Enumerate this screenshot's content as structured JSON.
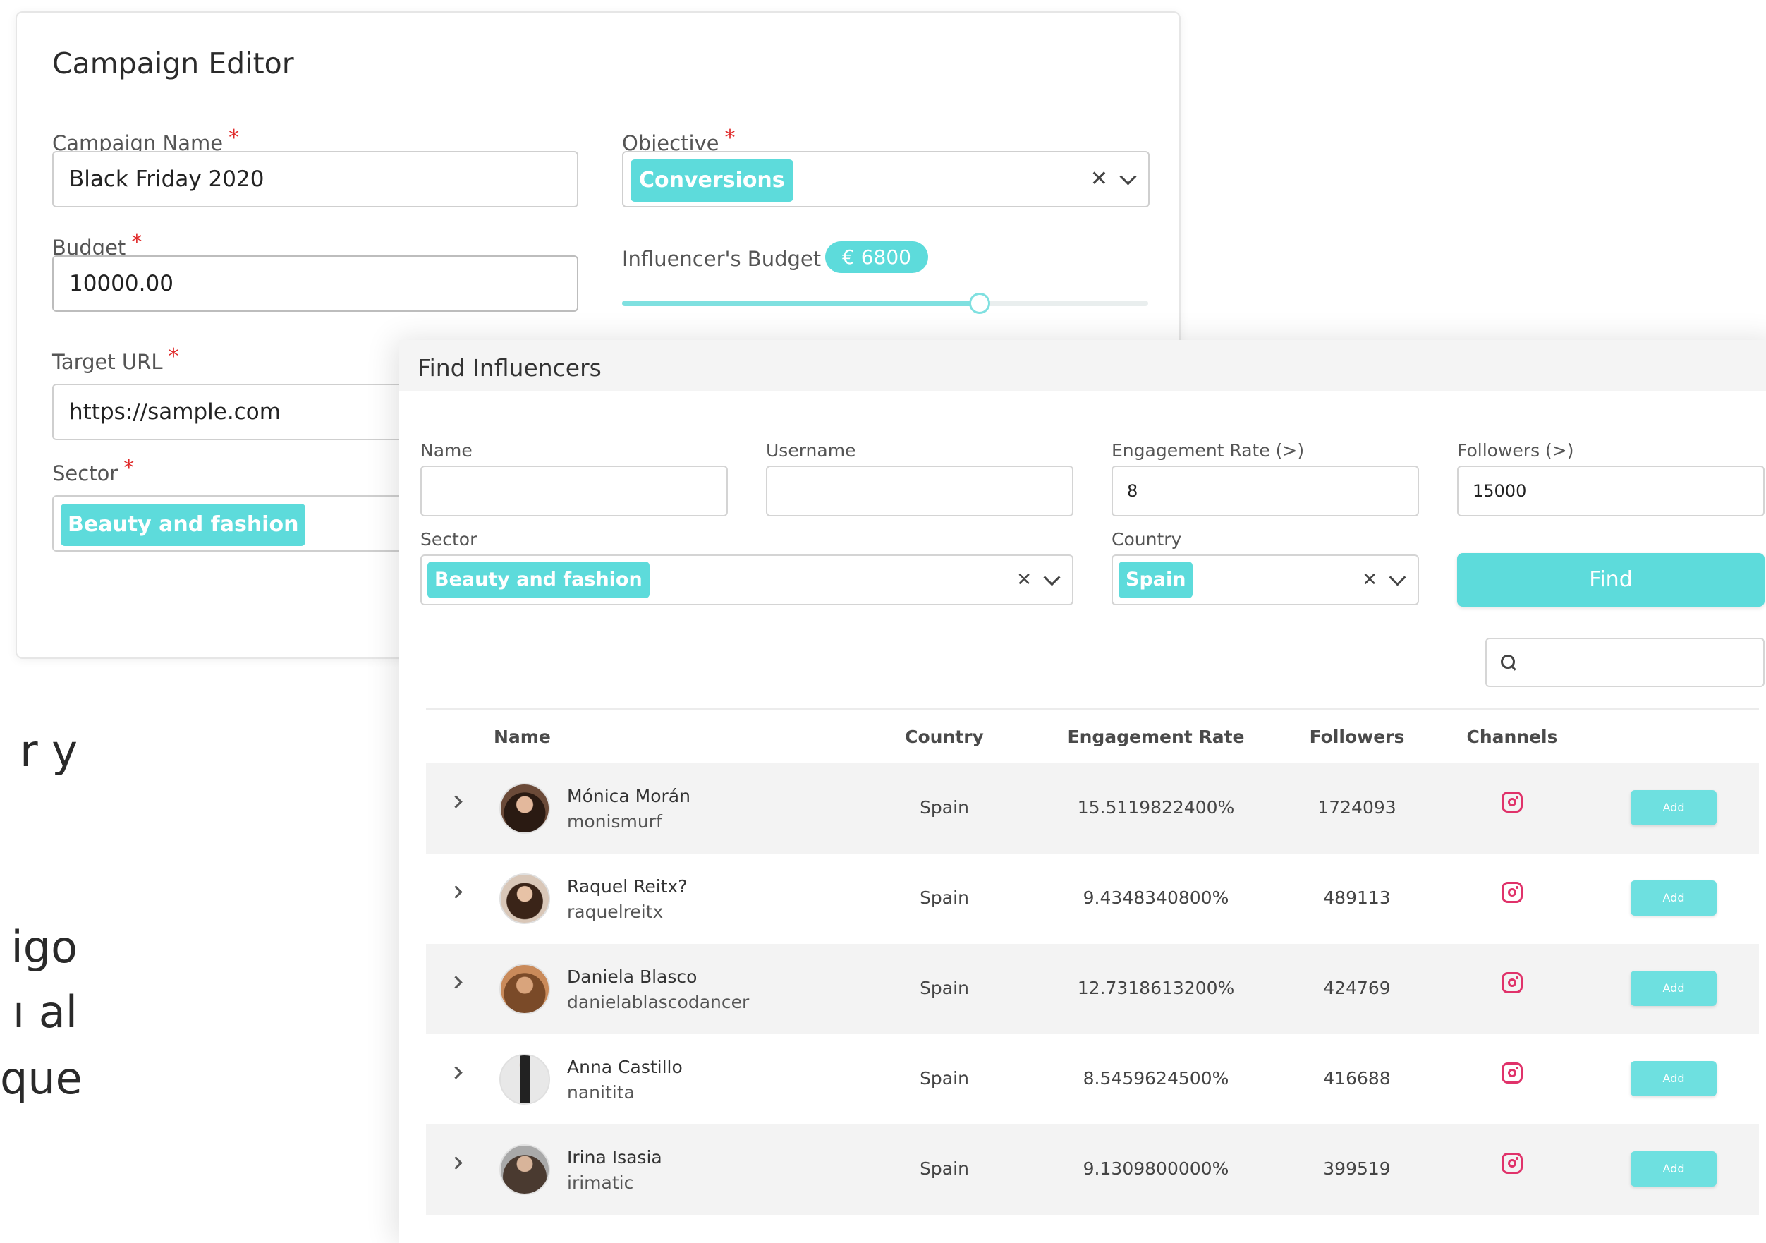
{
  "background_text": [
    "r  y",
    "igo",
    "ı al",
    "que"
  ],
  "campaign_editor": {
    "title": "Campaign Editor",
    "campaign_name": {
      "label": "Campaign Name",
      "required_mark": "*",
      "value": "Black Friday 2020"
    },
    "objective": {
      "label": "Objective",
      "required_mark": "*",
      "selected": "Conversions"
    },
    "budget": {
      "label": "Budget",
      "required_mark": "*",
      "value": "10000.00"
    },
    "influencer_budget": {
      "label": "Influencer's Budget",
      "badge": "€ 6800",
      "fraction": 0.68
    },
    "target_url": {
      "label": "Target URL",
      "required_mark": "*",
      "value": "https://sample.com"
    },
    "sector": {
      "label": "Sector",
      "required_mark": "*",
      "selected": "Beauty and fashion"
    }
  },
  "find_influencers": {
    "title": "Find Influencers",
    "filters": {
      "name": {
        "label": "Name",
        "value": ""
      },
      "username": {
        "label": "Username",
        "value": ""
      },
      "engagement_rate": {
        "label": "Engagement Rate (>)",
        "value": "8"
      },
      "followers": {
        "label": "Followers (>)",
        "value": "15000"
      },
      "sector": {
        "label": "Sector",
        "selected": "Beauty and fashion"
      },
      "country": {
        "label": "Country",
        "selected": "Spain"
      },
      "find_button": "Find"
    },
    "search": {
      "placeholder": ""
    },
    "columns": {
      "name": "Name",
      "country": "Country",
      "engagement_rate": "Engagement Rate",
      "followers": "Followers",
      "channels": "Channels"
    },
    "add_label": "Add",
    "rows": [
      {
        "name": "Mónica Morán",
        "username": "monismurf",
        "country": "Spain",
        "engagement_rate": "15.5119822400%",
        "followers": "1724093",
        "channel": "instagram-icon"
      },
      {
        "name": "Raquel Reitx?",
        "username": "raquelreitx",
        "country": "Spain",
        "engagement_rate": "9.4348340800%",
        "followers": "489113",
        "channel": "instagram-icon"
      },
      {
        "name": "Daniela Blasco",
        "username": "danielablascodancer",
        "country": "Spain",
        "engagement_rate": "12.7318613200%",
        "followers": "424769",
        "channel": "instagram-icon"
      },
      {
        "name": "Anna Castillo",
        "username": "nanitita",
        "country": "Spain",
        "engagement_rate": "8.5459624500%",
        "followers": "416688",
        "channel": "instagram-icon"
      },
      {
        "name": "Irina Isasia",
        "username": "irimatic",
        "country": "Spain",
        "engagement_rate": "9.1309800000%",
        "followers": "399519",
        "channel": "instagram-icon"
      }
    ]
  },
  "colors": {
    "accent": "#5ddbdb",
    "required": "#e02b2b",
    "instagram": "#e0326a"
  }
}
